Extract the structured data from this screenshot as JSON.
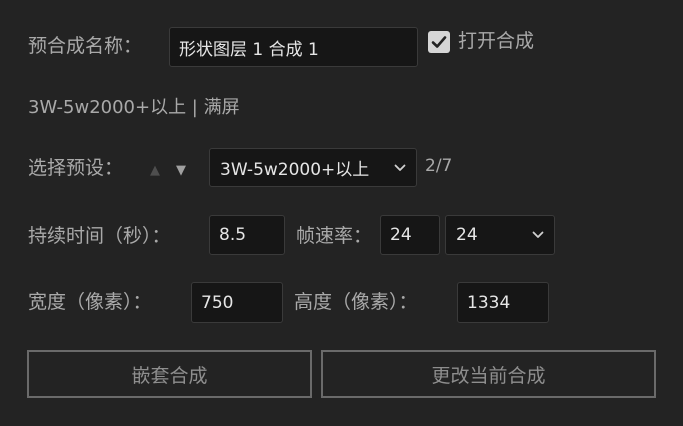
{
  "comp_name": {
    "label": "预合成名称：",
    "value": "形状图层 1 合成 1"
  },
  "open_comp": {
    "label": "打开合成",
    "checked": true
  },
  "preset_summary": "3W-5w2000+以上 | 满屏",
  "preset": {
    "label": "选择预设：",
    "up_icon": "triangle-up-icon",
    "down_icon": "triangle-down-icon",
    "selected": "3W-5w2000+以上",
    "counter": "2/7"
  },
  "duration": {
    "label": "持续时间（秒）：",
    "value": "8.5"
  },
  "frame_rate": {
    "label": "帧速率：",
    "value": "24",
    "selected": "24"
  },
  "width": {
    "label": "宽度（像素）：",
    "value": "750"
  },
  "height": {
    "label": "高度（像素）：",
    "value": "1334"
  },
  "buttons": {
    "nest_comp": "嵌套合成",
    "change_current_comp": "更改当前合成"
  },
  "colors": {
    "background": "#232323",
    "field": "#161616",
    "text": "#a9a9a9",
    "value_text": "#e6e6e6"
  }
}
